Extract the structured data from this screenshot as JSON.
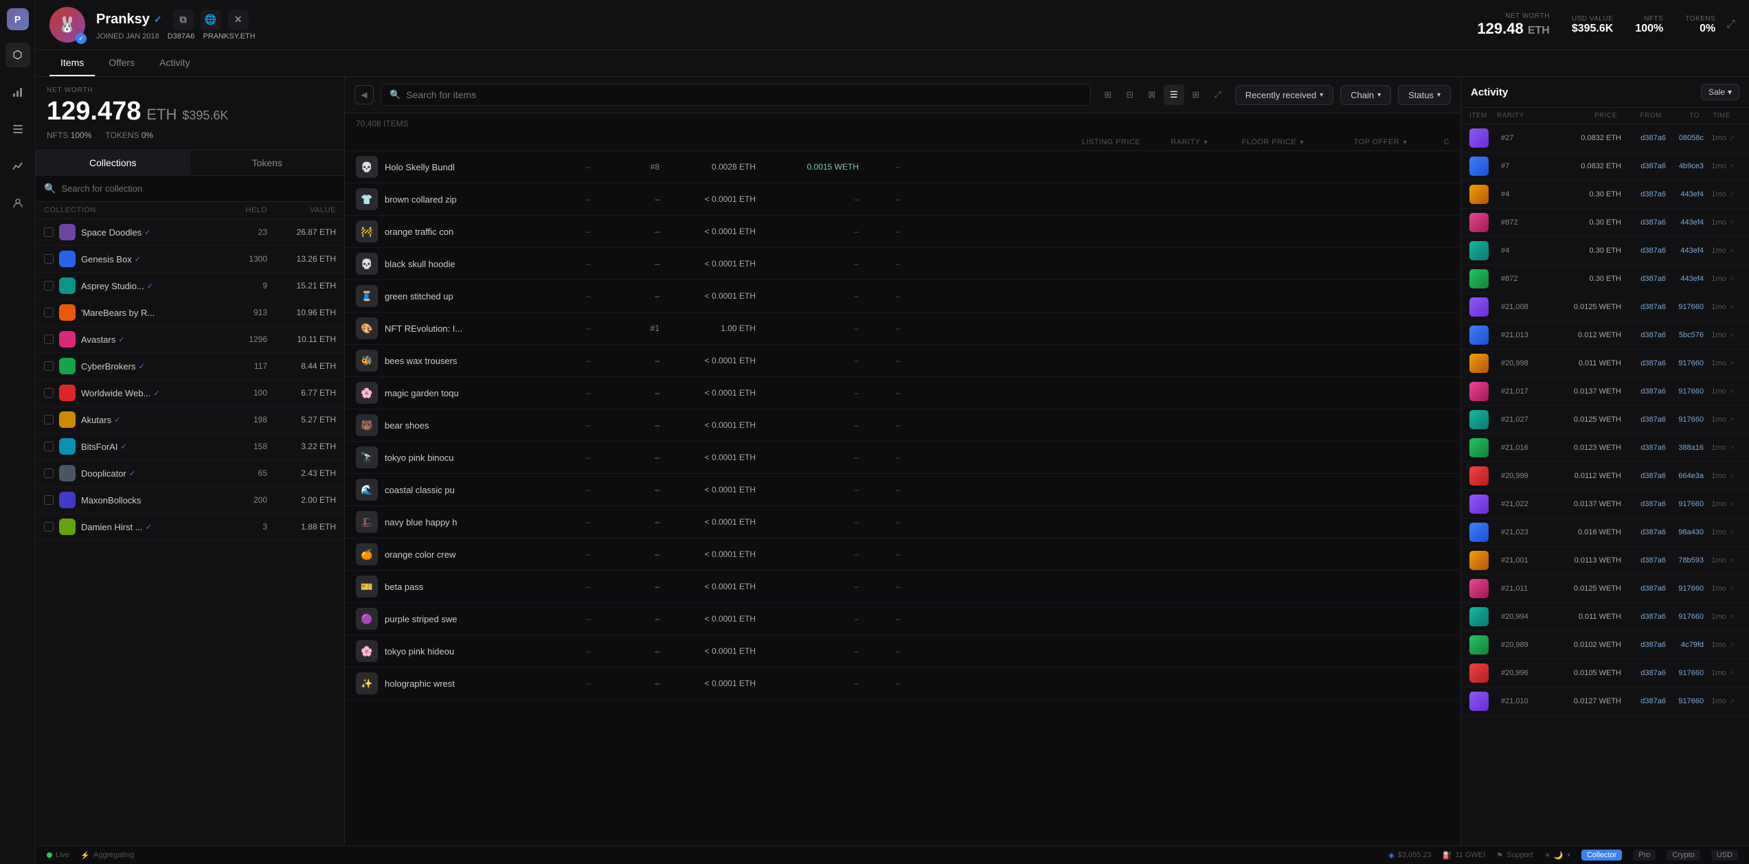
{
  "sidebar": {
    "icons": [
      {
        "name": "home-icon",
        "symbol": "⬡"
      },
      {
        "name": "chart-icon",
        "symbol": "📊"
      },
      {
        "name": "list-icon",
        "symbol": "☰"
      },
      {
        "name": "analytics-icon",
        "symbol": "📈"
      },
      {
        "name": "user-icon",
        "symbol": "👤"
      }
    ]
  },
  "header": {
    "username": "Pranksy",
    "joined": "JOINED JAN 2018",
    "address": "D387A6",
    "ens": "PRANKSY.ETH",
    "net_worth_label": "NET WORTH",
    "net_worth_eth": "129.48",
    "net_worth_eth_unit": "ETH",
    "net_worth_usd_label": "USD VALUE",
    "net_worth_usd": "$395.6K",
    "nfts_label": "NFTS",
    "nfts_value": "100%",
    "tokens_label": "TOKENS",
    "tokens_value": "0%"
  },
  "tabs": [
    {
      "label": "Items",
      "active": true
    },
    {
      "label": "Offers",
      "active": false
    },
    {
      "label": "Activity",
      "active": false
    }
  ],
  "left_panel": {
    "net_worth_label": "NET WORTH",
    "net_worth_eth": "129.478",
    "eth_symbol": "ETH",
    "net_worth_usd": "$395.6K",
    "nfts_label": "NFTS",
    "nfts_value": "100%",
    "tokens_label": "TOKENS",
    "tokens_value": "0%",
    "sub_tabs": [
      "Collections",
      "Tokens"
    ],
    "search_placeholder": "Search for collection",
    "collection_header": {
      "name": "COLLECTION",
      "held": "HELD",
      "value": "VALUE"
    },
    "collections": [
      {
        "name": "Space Doodles",
        "verified": true,
        "held": "23",
        "value": "26.87 ETH",
        "color": "icon-purple"
      },
      {
        "name": "Genesis Box",
        "verified": true,
        "held": "1300",
        "value": "13.26 ETH",
        "color": "icon-blue"
      },
      {
        "name": "Asprey Studio...",
        "verified": true,
        "held": "9",
        "value": "15.21 ETH",
        "color": "icon-teal"
      },
      {
        "name": "'MareBears by R...",
        "verified": false,
        "held": "913",
        "value": "10.96 ETH",
        "color": "icon-orange"
      },
      {
        "name": "Avastars",
        "verified": true,
        "held": "1296",
        "value": "10.11 ETH",
        "color": "icon-pink"
      },
      {
        "name": "CyberBrokers",
        "verified": true,
        "held": "117",
        "value": "8.44 ETH",
        "color": "icon-green"
      },
      {
        "name": "Worldwide Web...",
        "verified": true,
        "held": "100",
        "value": "6.77 ETH",
        "color": "icon-red"
      },
      {
        "name": "Akutars",
        "verified": true,
        "held": "198",
        "value": "5.27 ETH",
        "color": "icon-yellow"
      },
      {
        "name": "BitsForAI",
        "verified": true,
        "held": "158",
        "value": "3.22 ETH",
        "color": "icon-cyan"
      },
      {
        "name": "Dooplicator",
        "verified": true,
        "held": "65",
        "value": "2.43 ETH",
        "color": "icon-gray"
      },
      {
        "name": "MaxonBollocks",
        "verified": false,
        "held": "200",
        "value": "2.00 ETH",
        "color": "icon-indigo"
      },
      {
        "name": "Damien Hirst ...",
        "verified": true,
        "held": "3",
        "value": "1.88 ETH",
        "color": "icon-lime"
      }
    ]
  },
  "items_panel": {
    "search_placeholder": "Search for items",
    "filter_recently_received": "Recently received",
    "filter_chain": "Chain",
    "filter_status": "Status",
    "items_count": "70,408 ITEMS",
    "columns": {
      "item": "LISTING PRICE",
      "rarity": "RARITY",
      "floor": "FLOOR PRICE",
      "offer": "TOP OFFER",
      "c": "C"
    },
    "items": [
      {
        "name": "Holo Skelly Bundl",
        "emoji": "💀",
        "listing": "–",
        "rarity": "#8",
        "floor": "0.0028 ETH",
        "offer": "0.0015 WETH",
        "c": "",
        "offer_color": "teal"
      },
      {
        "name": "brown collared zip",
        "emoji": "👕",
        "listing": "–",
        "rarity": "–",
        "floor": "< 0.0001 ETH",
        "offer": "–",
        "c": ""
      },
      {
        "name": "orange traffic con",
        "emoji": "🚧",
        "listing": "–",
        "rarity": "–",
        "floor": "< 0.0001 ETH",
        "offer": "–",
        "c": ""
      },
      {
        "name": "black skull hoodie",
        "emoji": "💀",
        "listing": "–",
        "rarity": "–",
        "floor": "< 0.0001 ETH",
        "offer": "–",
        "c": ""
      },
      {
        "name": "green stitched up",
        "emoji": "🧵",
        "listing": "–",
        "rarity": "–",
        "floor": "< 0.0001 ETH",
        "offer": "–",
        "c": ""
      },
      {
        "name": "NFT REvolution: I...",
        "emoji": "🎨",
        "listing": "–",
        "rarity": "#1",
        "floor": "1.00 ETH",
        "offer": "–",
        "c": ""
      },
      {
        "name": "bees wax trousers",
        "emoji": "🐝",
        "listing": "–",
        "rarity": "–",
        "floor": "< 0.0001 ETH",
        "offer": "–",
        "c": ""
      },
      {
        "name": "magic garden toqu",
        "emoji": "🌸",
        "listing": "–",
        "rarity": "–",
        "floor": "< 0.0001 ETH",
        "offer": "–",
        "c": ""
      },
      {
        "name": "bear shoes",
        "emoji": "🐻",
        "listing": "–",
        "rarity": "–",
        "floor": "< 0.0001 ETH",
        "offer": "–",
        "c": ""
      },
      {
        "name": "tokyo pink binocu",
        "emoji": "🔭",
        "listing": "–",
        "rarity": "–",
        "floor": "< 0.0001 ETH",
        "offer": "–",
        "c": ""
      },
      {
        "name": "coastal classic pu",
        "emoji": "🌊",
        "listing": "–",
        "rarity": "–",
        "floor": "< 0.0001 ETH",
        "offer": "–",
        "c": ""
      },
      {
        "name": "navy blue happy h",
        "emoji": "🎩",
        "listing": "–",
        "rarity": "–",
        "floor": "< 0.0001 ETH",
        "offer": "–",
        "c": ""
      },
      {
        "name": "orange color crew",
        "emoji": "🍊",
        "listing": "–",
        "rarity": "–",
        "floor": "< 0.0001 ETH",
        "offer": "–",
        "c": ""
      },
      {
        "name": "beta pass",
        "emoji": "🎫",
        "listing": "–",
        "rarity": "–",
        "floor": "< 0.0001 ETH",
        "offer": "–",
        "c": ""
      },
      {
        "name": "purple striped swe",
        "emoji": "🟣",
        "listing": "–",
        "rarity": "–",
        "floor": "< 0.0001 ETH",
        "offer": "–",
        "c": ""
      },
      {
        "name": "tokyo pink hideou",
        "emoji": "🌸",
        "listing": "–",
        "rarity": "–",
        "floor": "< 0.0001 ETH",
        "offer": "–",
        "c": ""
      },
      {
        "name": "holographic wrest",
        "emoji": "✨",
        "listing": "–",
        "rarity": "–",
        "floor": "< 0.0001 ETH",
        "offer": "–",
        "c": ""
      }
    ]
  },
  "activity_panel": {
    "title": "Activity",
    "filter_label": "Sale",
    "columns": {
      "item": "ITEM",
      "rarity": "RARITY",
      "price": "PRICE",
      "from": "FROM",
      "to": "TO",
      "time": "TIME"
    },
    "rows": [
      {
        "rarity": "#27",
        "price": "0.0832 ETH",
        "from": "d387a6",
        "to": "08058c",
        "time": "1mo",
        "color": "act-purple"
      },
      {
        "rarity": "#7",
        "price": "0.0832 ETH",
        "from": "d387a6",
        "to": "4b9ce3",
        "time": "1mo",
        "color": "act-blue"
      },
      {
        "rarity": "#4",
        "price": "0.30 ETH",
        "from": "d387a6",
        "to": "443ef4",
        "time": "1mo",
        "color": "act-orange"
      },
      {
        "rarity": "#872",
        "price": "0.30 ETH",
        "from": "d387a6",
        "to": "443ef4",
        "time": "1mo",
        "color": "act-pink"
      },
      {
        "rarity": "#4",
        "price": "0.30 ETH",
        "from": "d387a6",
        "to": "443ef4",
        "time": "1mo",
        "color": "act-teal"
      },
      {
        "rarity": "#872",
        "price": "0.30 ETH",
        "from": "d387a6",
        "to": "443ef4",
        "time": "1mo",
        "color": "act-green"
      },
      {
        "rarity": "#21,008",
        "price": "0.0125 WETH",
        "from": "d387a6",
        "to": "917660",
        "time": "1mo",
        "color": "act-purple"
      },
      {
        "rarity": "#21,013",
        "price": "0.012 WETH",
        "from": "d387a6",
        "to": "5bc576",
        "time": "1mo",
        "color": "act-blue"
      },
      {
        "rarity": "#20,998",
        "price": "0.011 WETH",
        "from": "d387a6",
        "to": "917660",
        "time": "1mo",
        "color": "act-orange"
      },
      {
        "rarity": "#21,017",
        "price": "0.0137 WETH",
        "from": "d387a6",
        "to": "917660",
        "time": "1mo",
        "color": "act-pink"
      },
      {
        "rarity": "#21,027",
        "price": "0.0125 WETH",
        "from": "d387a6",
        "to": "917660",
        "time": "1mo",
        "color": "act-teal"
      },
      {
        "rarity": "#21,016",
        "price": "0.0123 WETH",
        "from": "d387a6",
        "to": "388a16",
        "time": "1mo",
        "color": "act-green"
      },
      {
        "rarity": "#20,999",
        "price": "0.0112 WETH",
        "from": "d387a6",
        "to": "664e3a",
        "time": "1mo",
        "color": "act-red"
      },
      {
        "rarity": "#21,022",
        "price": "0.0137 WETH",
        "from": "d387a6",
        "to": "917660",
        "time": "1mo",
        "color": "act-purple"
      },
      {
        "rarity": "#21,023",
        "price": "0.016 WETH",
        "from": "d387a6",
        "to": "98a430",
        "time": "1mo",
        "color": "act-blue"
      },
      {
        "rarity": "#21,001",
        "price": "0.0113 WETH",
        "from": "d387a6",
        "to": "78b593",
        "time": "1mo",
        "color": "act-orange"
      },
      {
        "rarity": "#21,011",
        "price": "0.0125 WETH",
        "from": "d387a6",
        "to": "917660",
        "time": "1mo",
        "color": "act-pink"
      },
      {
        "rarity": "#20,994",
        "price": "0.011 WETH",
        "from": "d387a6",
        "to": "917660",
        "time": "1mo",
        "color": "act-teal"
      },
      {
        "rarity": "#20,989",
        "price": "0.0102 WETH",
        "from": "d387a6",
        "to": "4c79fd",
        "time": "1mo",
        "color": "act-green"
      },
      {
        "rarity": "#20,996",
        "price": "0.0105 WETH",
        "from": "d387a6",
        "to": "917660",
        "time": "1mo",
        "color": "act-red"
      },
      {
        "rarity": "#21,010",
        "price": "0.0127 WETH",
        "from": "d387a6",
        "to": "917660",
        "time": "1mo",
        "color": "act-purple"
      }
    ]
  },
  "footer": {
    "live_label": "Live",
    "aggregating_label": "Aggregating",
    "price_label": "$3,055.23",
    "gas_label": "11 GWEI",
    "support_label": "Support",
    "collector_label": "Collector",
    "pro_label": "Pro",
    "crypto_label": "Crypto",
    "usd_label": "USD"
  }
}
